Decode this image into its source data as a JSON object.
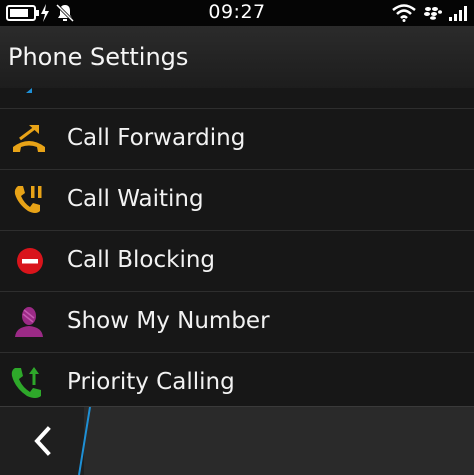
{
  "status_bar": {
    "time": "09:27",
    "icons": [
      "battery-icon",
      "charging-icon",
      "notifications-muted-icon",
      "wifi-icon",
      "blackberry-icon",
      "signal-icon"
    ]
  },
  "header": {
    "title": "Phone Settings"
  },
  "list": {
    "items": [
      {
        "label": "Call Forwarding",
        "icon": "call-forwarding-icon",
        "color": "#e8a317"
      },
      {
        "label": "Call Waiting",
        "icon": "call-waiting-icon",
        "color": "#e8a317"
      },
      {
        "label": "Call Blocking",
        "icon": "call-blocking-icon",
        "color": "#d9141b"
      },
      {
        "label": "Show My Number",
        "icon": "show-my-number-icon",
        "color": "#9b2a86"
      },
      {
        "label": "Priority Calling",
        "icon": "priority-calling-icon",
        "color": "#2ea82a"
      }
    ]
  },
  "action_bar": {
    "back_icon": "back-chevron-icon"
  },
  "colors": {
    "accent": "#1e90d6",
    "background": "#171717",
    "text": "#f2f2f2"
  }
}
